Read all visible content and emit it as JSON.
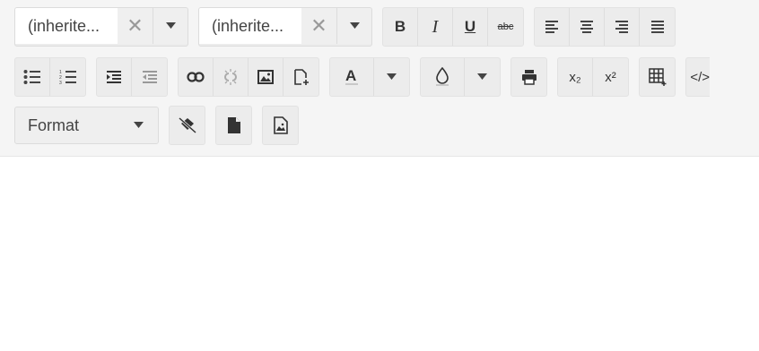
{
  "font_family": {
    "value": "(inherite..."
  },
  "font_size": {
    "value": "(inherite..."
  },
  "format_select": {
    "value": "Format"
  },
  "colors": {
    "toolbar_bg": "#f5f5f5",
    "button_bg": "#ececec",
    "icon": "#333333"
  },
  "icons": [
    "bold-icon",
    "italic-icon",
    "underline-icon",
    "strikethrough-icon",
    "align-left-icon",
    "align-center-icon",
    "align-right-icon",
    "justify-icon",
    "bullet-list-icon",
    "numbered-list-icon",
    "indent-icon",
    "outdent-icon",
    "link-icon",
    "unlink-icon",
    "image-icon",
    "insert-file-icon",
    "font-color-icon",
    "highlight-color-icon",
    "print-icon",
    "subscript-icon",
    "superscript-icon",
    "table-icon",
    "code-view-icon",
    "clear-formatting-icon",
    "new-document-icon",
    "image-file-icon"
  ],
  "labels": {
    "bold": "B",
    "italic": "I",
    "underline": "U",
    "strikethrough": "abc",
    "font_color": "A",
    "subscript": "x₂",
    "superscript": "x²",
    "code": "</>"
  }
}
